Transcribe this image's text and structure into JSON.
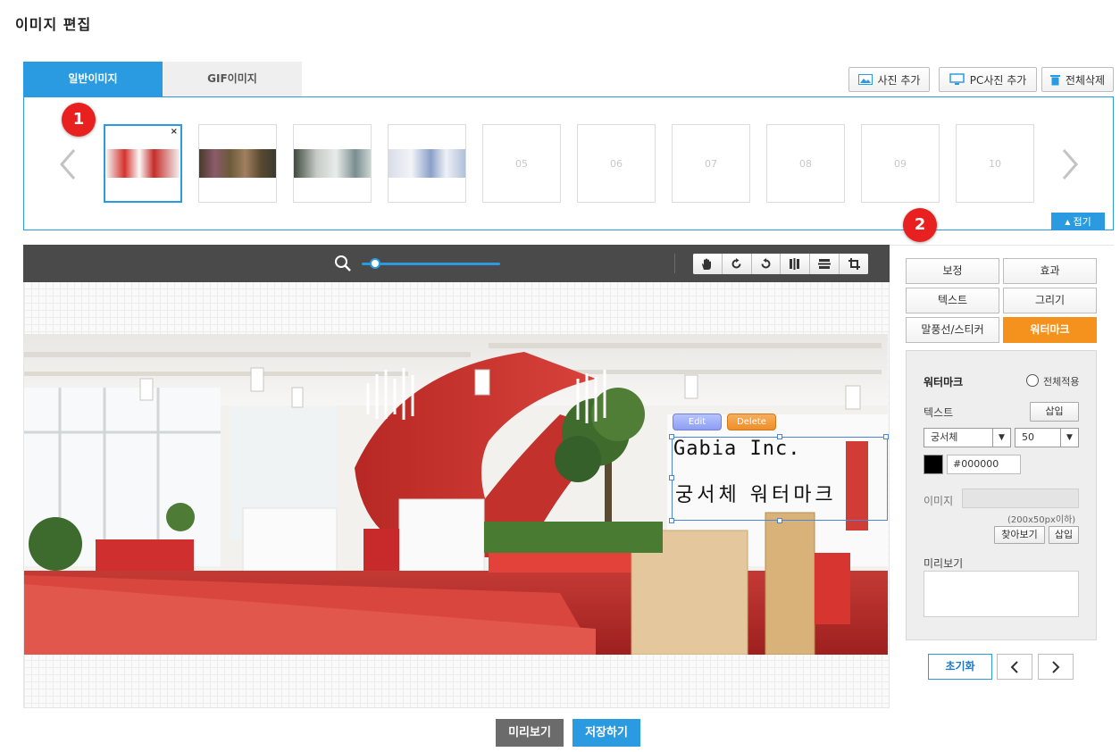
{
  "page": {
    "title": "이미지 편집"
  },
  "tabs": [
    {
      "label": "일반이미지",
      "active": true
    },
    {
      "label": "GIF이미지",
      "active": false
    }
  ],
  "top_buttons": {
    "add_photo": "사진 추가",
    "add_pc_photo": "PC사진 추가",
    "delete_all": "전체삭제"
  },
  "thumbnails": {
    "close": "×",
    "slots": [
      "",
      "",
      "",
      "",
      "05",
      "06",
      "07",
      "08",
      "09",
      "10"
    ],
    "fold_label": "접기"
  },
  "badges": {
    "one": "1",
    "two": "2"
  },
  "toolbar": {
    "tools": [
      "hand-icon",
      "rotate-left-icon",
      "rotate-right-icon",
      "flip-vertical-icon",
      "flip-horizontal-icon",
      "crop-icon"
    ],
    "zoom_level": 0.1
  },
  "watermark_overlay": {
    "line1": "Gabia Inc.",
    "line2": "궁서체 워터마크",
    "edit_label": "Edit",
    "delete_label": "Delete"
  },
  "functions": [
    {
      "label": "보정",
      "active": false
    },
    {
      "label": "효과",
      "active": false
    },
    {
      "label": "텍스트",
      "active": false
    },
    {
      "label": "그리기",
      "active": false
    },
    {
      "label": "말풍선/스티커",
      "active": false
    },
    {
      "label": "워터마크",
      "active": true
    }
  ],
  "watermark_panel": {
    "title": "워터마크",
    "apply_all_label": "전체적용",
    "text_label": "텍스트",
    "insert_label": "삽입",
    "font_value": "궁서체",
    "size_value": "50",
    "color_value": "#000000",
    "image_label": "이미지",
    "image_hint": "(200x50px이하)",
    "browse_label": "찾아보기",
    "insert2_label": "삽입",
    "preview_label": "미리보기"
  },
  "nav": {
    "reset_label": "초기화"
  },
  "bottom": {
    "preview_label": "미리보기",
    "save_label": "저장하기"
  },
  "colors": {
    "accent": "#2a9be0",
    "active_orange": "#f5921e",
    "badge_red": "#e8201f",
    "toolbar_dark": "#4a4a4a"
  }
}
